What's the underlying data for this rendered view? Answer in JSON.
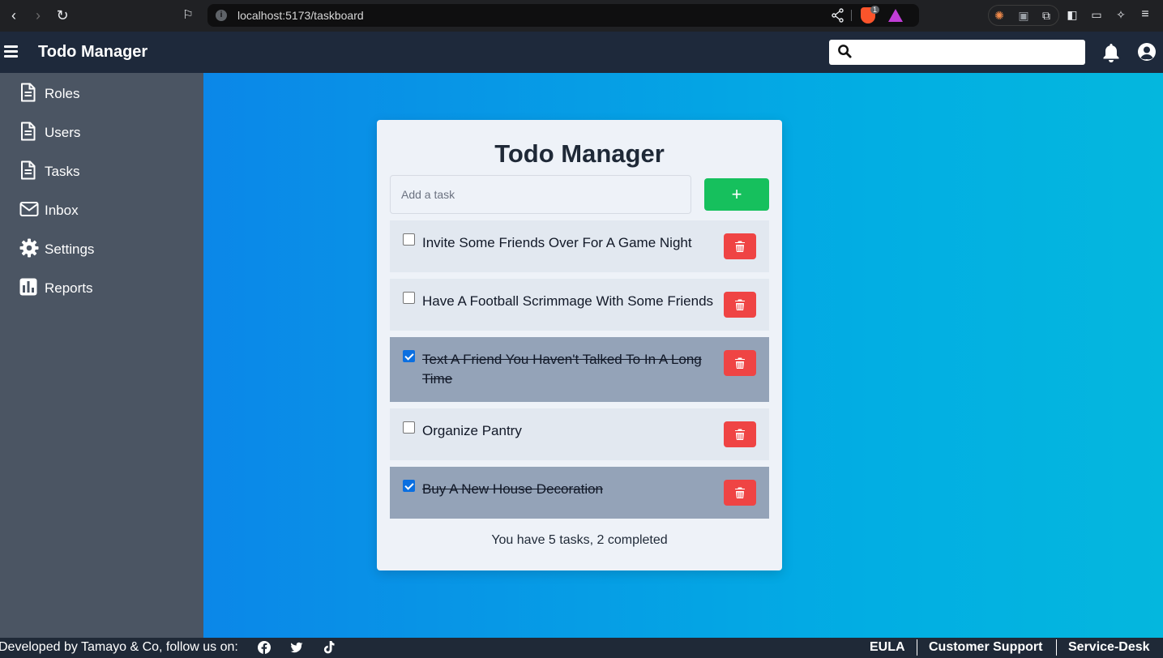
{
  "browser": {
    "url": "localhost:5173/taskboard",
    "brave_badge": "1"
  },
  "header": {
    "title": "Todo Manager",
    "search_placeholder": ""
  },
  "sidebar": {
    "items": [
      {
        "label": "Roles",
        "icon": "document-icon"
      },
      {
        "label": "Users",
        "icon": "document-icon"
      },
      {
        "label": "Tasks",
        "icon": "document-icon"
      },
      {
        "label": "Inbox",
        "icon": "envelope-icon"
      },
      {
        "label": "Settings",
        "icon": "gear-icon"
      },
      {
        "label": "Reports",
        "icon": "chart-icon"
      }
    ]
  },
  "card": {
    "title": "Todo Manager",
    "input_placeholder": "Add a task",
    "add_label": "+",
    "tasks": [
      {
        "text": "Invite Some Friends Over For A Game Night",
        "completed": false
      },
      {
        "text": "Have A Football Scrimmage With Some Friends",
        "completed": false
      },
      {
        "text": "Text A Friend You Haven't Talked To In A Long Time",
        "completed": true
      },
      {
        "text": "Organize Pantry",
        "completed": false
      },
      {
        "text": "Buy A New House Decoration",
        "completed": true
      }
    ],
    "summary": "You have 5 tasks, 2 completed"
  },
  "footer": {
    "developed_by": "Developed by Tamayo & Co, follow us on:",
    "links": [
      "EULA",
      "Customer Support",
      "Service-Desk"
    ]
  },
  "colors": {
    "header_bg": "#1e293b",
    "sidebar_bg": "#4b5563",
    "add_button": "#16c05d",
    "delete_button": "#ef4444",
    "completed_row": "#94a3b8",
    "open_row": "#e2e8f0"
  }
}
